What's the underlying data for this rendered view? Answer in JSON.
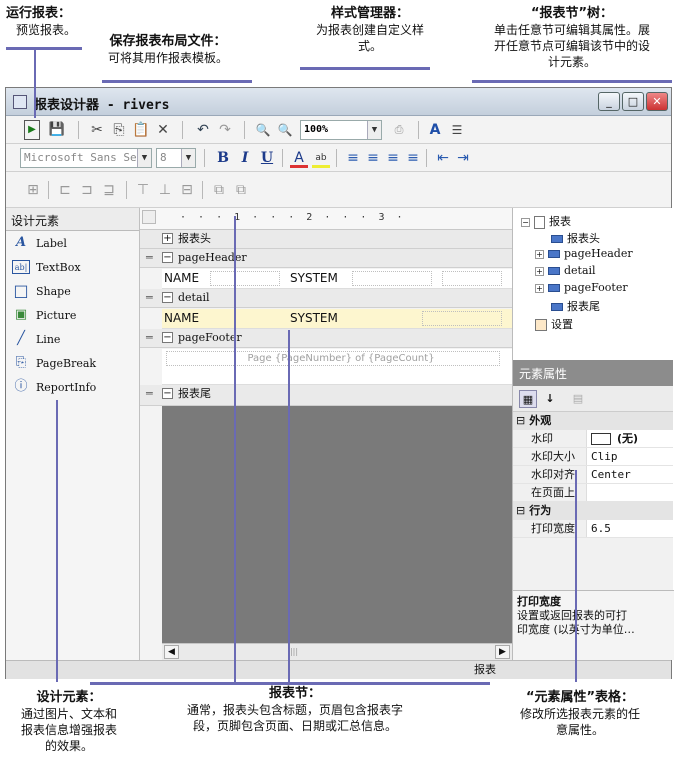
{
  "callouts": {
    "run_report": {
      "title": "运行报表：",
      "desc": "预览报表。"
    },
    "save_layout": {
      "title": "保存报表布局文件：",
      "desc": "可将其用作报表模板。"
    },
    "style_manager": {
      "title": "样式管理器：",
      "desc1": "为报表创建自定义样",
      "desc2": "式。"
    },
    "report_tree": {
      "title": "“报表节”树：",
      "desc1": "单击任意节可编辑其属性。展",
      "desc2": "开任意节点可编辑该节中的设",
      "desc3": "计元素。"
    },
    "design_elements": {
      "title": "设计元素：",
      "desc1": "通过图片、文本和",
      "desc2": "报表信息增强报表",
      "desc3": "的效果。"
    },
    "report_sections": {
      "title": "报表节：",
      "desc1": "通常，报表头包含标题，页眉包含报表字",
      "desc2": "段，页脚包含页面、日期或汇总信息。"
    },
    "element_props": {
      "title": "“元素属性”表格：",
      "desc1": "修改所选报表元素的任",
      "desc2": "意属性。"
    }
  },
  "window": {
    "title": "报表设计器 - rivers",
    "minimize": "_",
    "maximize": "□",
    "close": "✕"
  },
  "toolbar1": {
    "run": "▶",
    "save": "💾",
    "cut": "✂",
    "copy": "⎘",
    "paste": "📋",
    "delete": "✕",
    "undo": "↶",
    "redo": "↷",
    "zoom_in": "🔍",
    "zoom_out": "🔍",
    "zoom_value": "100%",
    "style": "A",
    "props": "☰"
  },
  "toolbar2": {
    "font_name": "Microsoft Sans Se",
    "font_size": "8",
    "bold": "B",
    "italic": "I",
    "underline": "U",
    "font_color": "A",
    "highlight": "ab"
  },
  "toolbox": {
    "title": "设计元素",
    "items": [
      {
        "label": "Label",
        "icon": "A"
      },
      {
        "label": "TextBox",
        "icon": "ab|"
      },
      {
        "label": "Shape",
        "icon": "□"
      },
      {
        "label": "Picture",
        "icon": "▣"
      },
      {
        "label": "Line",
        "icon": "╱"
      },
      {
        "label": "PageBreak",
        "icon": "⎘"
      },
      {
        "label": "ReportInfo",
        "icon": "ⓘ"
      }
    ]
  },
  "design": {
    "ruler": "· · · 1 · · · 2 · · · 3 ·",
    "bands": [
      {
        "label": "报表头",
        "exp": "+"
      },
      {
        "label": "pageHeader",
        "exp": "−"
      },
      {
        "label": "detail",
        "exp": "−"
      },
      {
        "label": "pageFooter",
        "exp": "−"
      },
      {
        "label": "报表尾",
        "exp": "−"
      }
    ],
    "header_name": "NAME",
    "header_system": "SYSTEM",
    "detail_name": "NAME",
    "detail_system": "SYSTEM",
    "footer_text": "Page {PageNumber} of {PageCount}"
  },
  "tree": {
    "root": "报表",
    "nodes": [
      "报表头",
      "pageHeader",
      "detail",
      "pageFooter",
      "报表尾"
    ],
    "settings": "设置"
  },
  "props": {
    "title": "元素属性",
    "cat_appearance": "外观",
    "cat_behavior": "行为",
    "rows": [
      {
        "key": "水印",
        "value": "(无)"
      },
      {
        "key": "水印大小",
        "value": "Clip"
      },
      {
        "key": "水印对齐",
        "value": "Center"
      },
      {
        "key": "在页面上",
        "value": ""
      }
    ],
    "behavior_rows": [
      {
        "key": "打印宽度",
        "value": "6.5"
      }
    ],
    "desc_title": "打印宽度",
    "desc_text1": "设置或返回报表的可打",
    "desc_text2": "印宽度 (以英寸为单位…"
  },
  "status": {
    "text": "报表"
  }
}
